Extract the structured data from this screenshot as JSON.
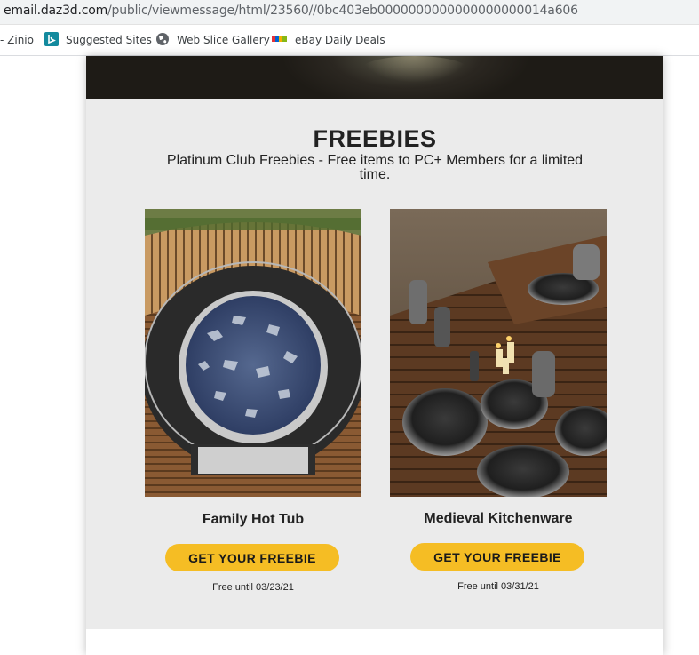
{
  "browser": {
    "url_host": "email.daz3d.com",
    "url_path": "/public/viewmessage/html/23560//0bc403eb0000000000000000000014a606"
  },
  "favorites": [
    {
      "label": "- Zinio",
      "icon": "none"
    },
    {
      "label": "Suggested Sites",
      "icon": "bing-icon"
    },
    {
      "label": "Web Slice Gallery",
      "icon": "globe-icon"
    },
    {
      "label": "eBay Daily Deals",
      "icon": "ebay-icon"
    }
  ],
  "freebies": {
    "title": "FREEBIES",
    "subtitle": "Platinum Club Freebies - Free items to PC+ Members for a limited time."
  },
  "products": [
    {
      "name": "Family Hot Tub",
      "cta": "GET YOUR FREEBIE",
      "until": "Free until 03/23/21"
    },
    {
      "name": "Medieval Kitchenware",
      "cta": "GET YOUR FREEBIE",
      "until": "Free until 03/31/21"
    }
  ],
  "colors": {
    "cta": "#f5bd24",
    "panel": "#ebebeb"
  }
}
